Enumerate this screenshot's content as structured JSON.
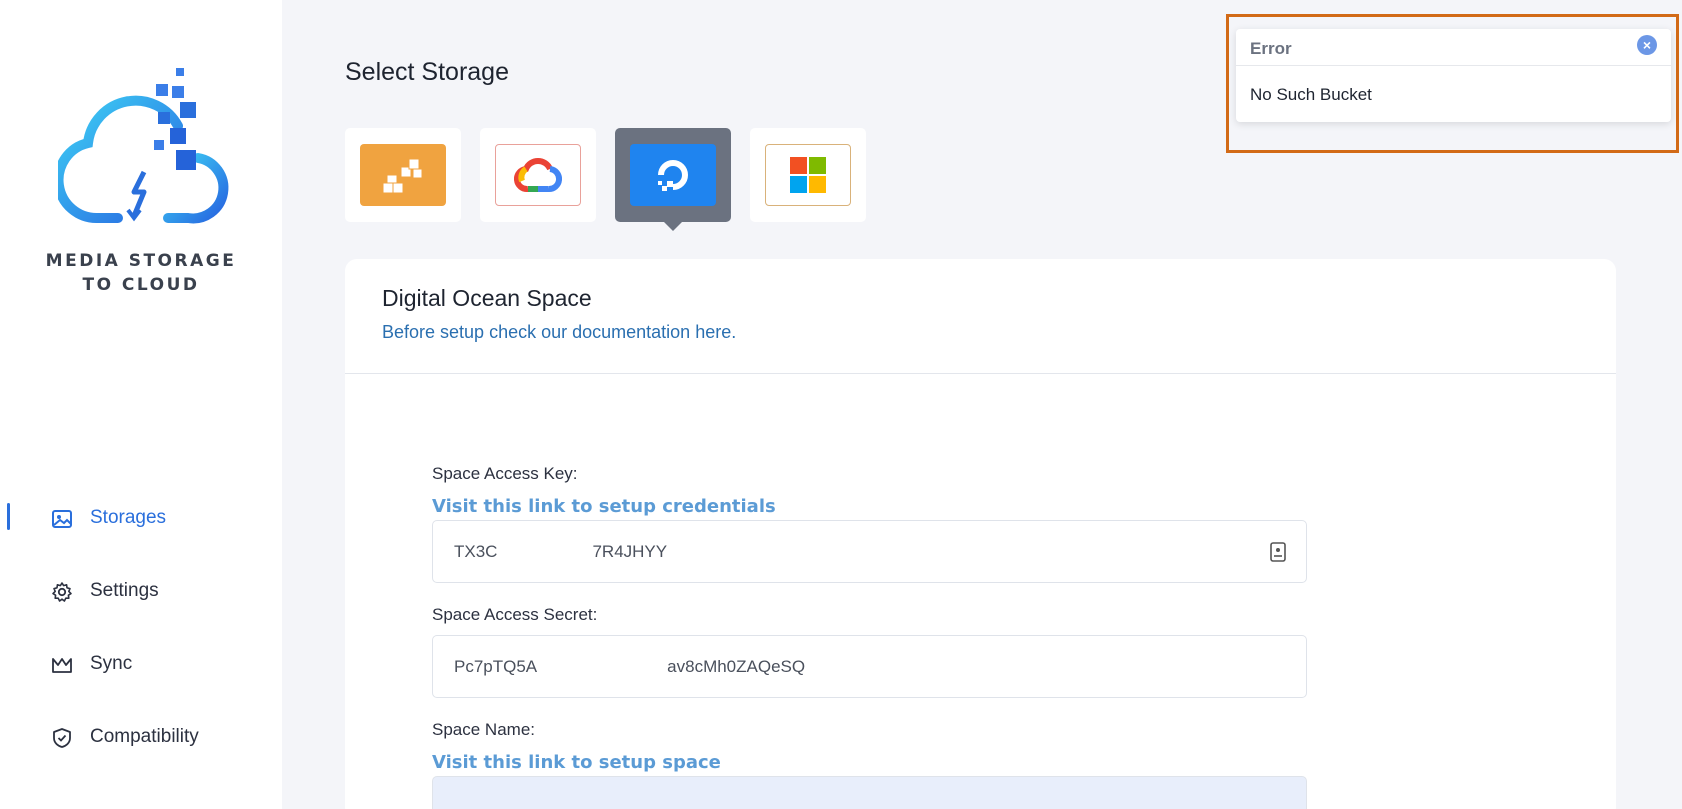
{
  "brand": {
    "logo_text_line1": "MEDIA STORAGE",
    "logo_text_line2": "TO CLOUD"
  },
  "nav": {
    "items": [
      {
        "label": "Storages",
        "icon": "image-icon",
        "active": true
      },
      {
        "label": "Settings",
        "icon": "gear-icon",
        "active": false
      },
      {
        "label": "Sync",
        "icon": "crown-icon",
        "active": false
      },
      {
        "label": "Compatibility",
        "icon": "shield-check-icon",
        "active": false
      }
    ]
  },
  "main": {
    "title": "Select Storage",
    "storages": [
      {
        "name": "amazon-s3",
        "selected": false
      },
      {
        "name": "google-cloud",
        "selected": false
      },
      {
        "name": "digital-ocean",
        "selected": true
      },
      {
        "name": "microsoft-azure",
        "selected": false
      }
    ],
    "card": {
      "title": "Digital Ocean Space",
      "subtitle": "Before setup check our documentation here.",
      "access_key": {
        "label": "Space Access Key:",
        "link": "Visit this link to setup credentials",
        "value_start": "TX3C",
        "value_end": "7R4JHYY"
      },
      "access_secret": {
        "label": "Space Access Secret:",
        "value_start": "Pc7pTQ5A",
        "value_end": "av8cMh0ZAQeSQ"
      },
      "space_name": {
        "label": "Space Name:",
        "link": "Visit this link to setup space"
      }
    }
  },
  "toast": {
    "title": "Error",
    "message": "No Such Bucket"
  },
  "colors": {
    "accent": "#2a6fdc",
    "highlight_frame": "#d26a17",
    "selected_tile": "#6b7280"
  }
}
